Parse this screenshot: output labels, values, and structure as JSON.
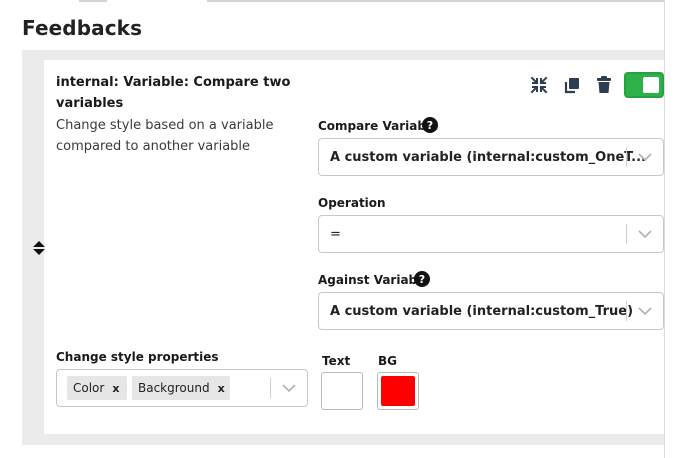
{
  "page": {
    "title": "Feedbacks"
  },
  "feedback": {
    "title": "internal: Variable: Compare two variables",
    "description": "Change style based on a variable compared to another variable",
    "enabled": true,
    "icons": [
      "collapse-icon",
      "copy-icon",
      "trash-icon",
      "drag-handle-icon"
    ]
  },
  "options": {
    "compare_variable": {
      "label": "Compare Variable",
      "help": "?",
      "value": "A custom variable (internal:custom_OneT..."
    },
    "operation": {
      "label": "Operation",
      "value": "="
    },
    "against_variable": {
      "label": "Against Variable",
      "help": "?",
      "value": "A custom variable (internal:custom_True)"
    },
    "style_properties": {
      "label": "Change style properties",
      "chips": [
        "Color",
        "Background"
      ],
      "chip_remove": "x"
    },
    "colors": {
      "text": {
        "label": "Text",
        "color": "#ffffff"
      },
      "bg": {
        "label": "BG",
        "color": "#ff0000"
      }
    }
  },
  "colors": {
    "toggle_on": "#2fb14a",
    "panel_bg": "#ebebeb"
  }
}
